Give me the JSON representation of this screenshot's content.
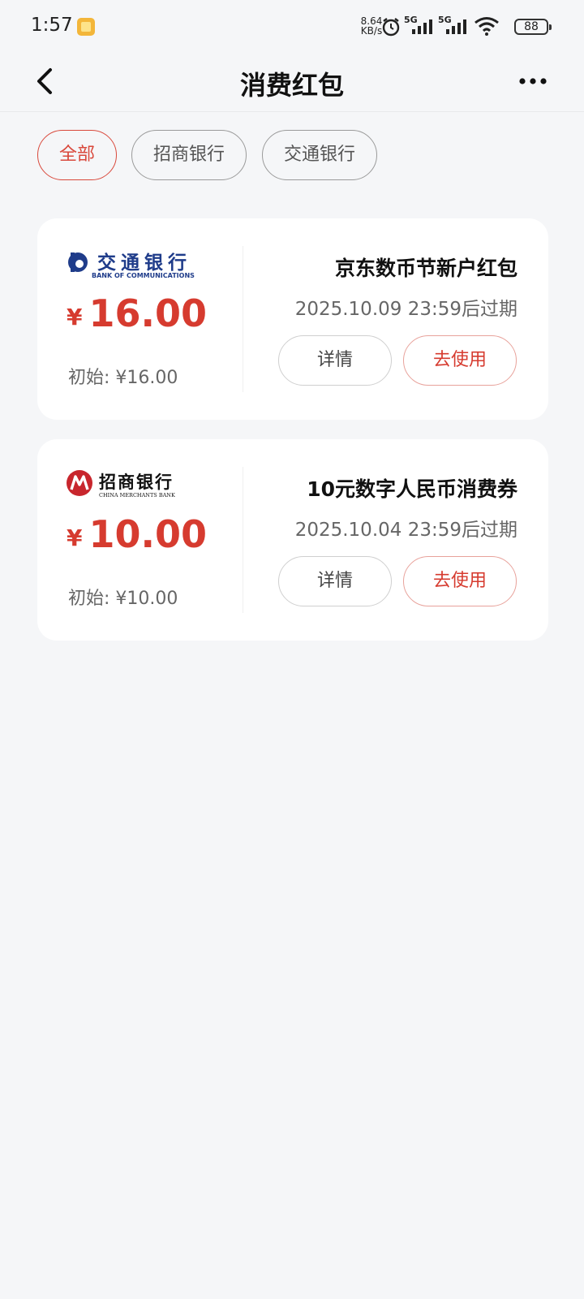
{
  "status_bar": {
    "time": "1:57",
    "net_speed_value": "8.64",
    "net_speed_unit": "KB/s",
    "signal_1": "5G",
    "signal_2": "5G",
    "battery": "88"
  },
  "header": {
    "title": "消费红包",
    "back_icon": "chevron-left-icon",
    "more_icon": "more-horizontal-icon"
  },
  "filters": [
    {
      "label": "全部",
      "active": true
    },
    {
      "label": "招商银行",
      "active": false
    },
    {
      "label": "交通银行",
      "active": false
    }
  ],
  "cards": [
    {
      "bank_logo_cn": "交通银行",
      "bank_logo_en": "BANK OF COMMUNICATIONS",
      "currency": "¥",
      "amount": "16.00",
      "initial_label": "初始:",
      "initial_value": "¥16.00",
      "title": "京东数币节新户红包",
      "expiry": "2025.10.09 23:59后过期",
      "detail_label": "详情",
      "use_label": "去使用"
    },
    {
      "bank_logo_cn": "招商银行",
      "bank_logo_en": "CHINA MERCHANTS BANK",
      "currency": "¥",
      "amount": "10.00",
      "initial_label": "初始:",
      "initial_value": "¥10.00",
      "title": "10元数字人民币消费券",
      "expiry": "2025.10.04 23:59后过期",
      "detail_label": "详情",
      "use_label": "去使用"
    }
  ],
  "colors": {
    "accent": "#d63b2f",
    "background": "#f5f6f8",
    "card": "#ffffff",
    "bocom_blue": "#1f3c8a",
    "cmb_red": "#c8262d"
  }
}
